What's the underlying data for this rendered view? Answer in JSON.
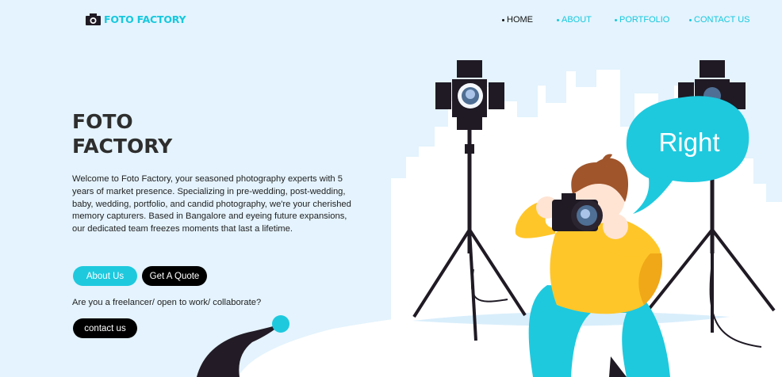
{
  "header": {
    "logo_text": "FOTO FACTORY",
    "nav": [
      {
        "label": "HOME",
        "active": true
      },
      {
        "label": "ABOUT",
        "active": false
      },
      {
        "label": "PORTFOLIO",
        "active": false
      },
      {
        "label": "CONTACT US",
        "active": false
      }
    ]
  },
  "hero": {
    "title_line1": "FOTO",
    "title_line2": "FACTORY",
    "description": "Welcome to Foto Factory, your seasoned photography experts with 5 years of market presence. Specializing in pre-wedding, post-wedding, baby, wedding, portfolio, and candid photography, we're your cherished memory capturers. Based in Bangalore and eyeing future expansions, our dedicated team freezes moments that last a lifetime.",
    "about_button": "About Us",
    "quote_button": "Get A Quote",
    "question": "Are you a freelancer/ open to work/ collaborate?",
    "contact_button": "contact us"
  },
  "illustration": {
    "speech_bubble_text": "Right"
  },
  "colors": {
    "background": "#e4f3fd",
    "accent": "#1ec9de",
    "dark": "#000000",
    "shirt": "#ffc629",
    "pants": "#1ec9de",
    "hair": "#a0552b"
  }
}
